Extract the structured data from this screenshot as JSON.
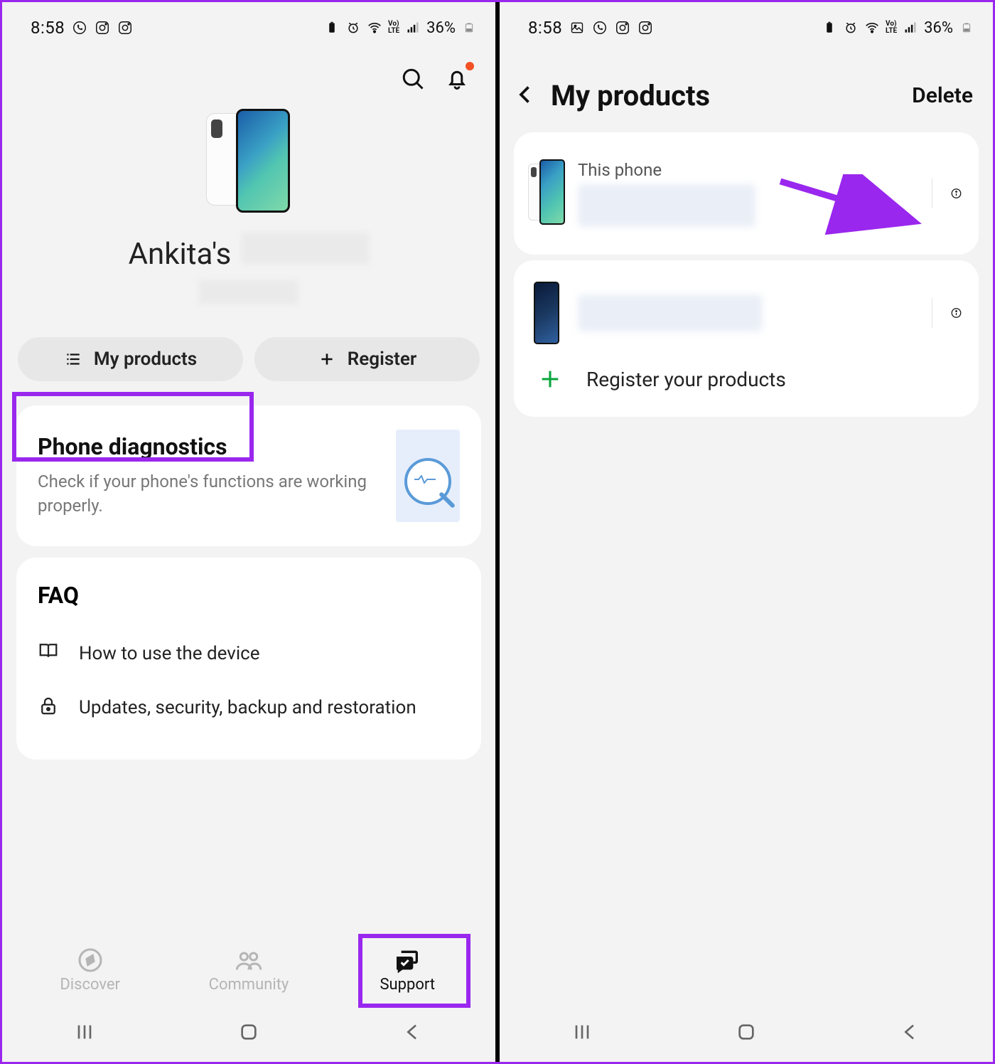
{
  "status": {
    "time": "8:58",
    "battery": "36%"
  },
  "screen1": {
    "owner_prefix": "Ankita's",
    "buttons": {
      "my_products": "My products",
      "register": "Register"
    },
    "diagnostics": {
      "title": "Phone diagnostics",
      "subtitle": "Check if your phone's functions are working properly."
    },
    "faq": {
      "title": "FAQ",
      "items": [
        "How to use the device",
        "Updates, security, backup and restoration"
      ]
    },
    "nav": {
      "discover": "Discover",
      "community": "Community",
      "support": "Support"
    }
  },
  "screen2": {
    "title": "My products",
    "delete": "Delete",
    "this_phone": "This phone",
    "register_products": "Register your products"
  }
}
